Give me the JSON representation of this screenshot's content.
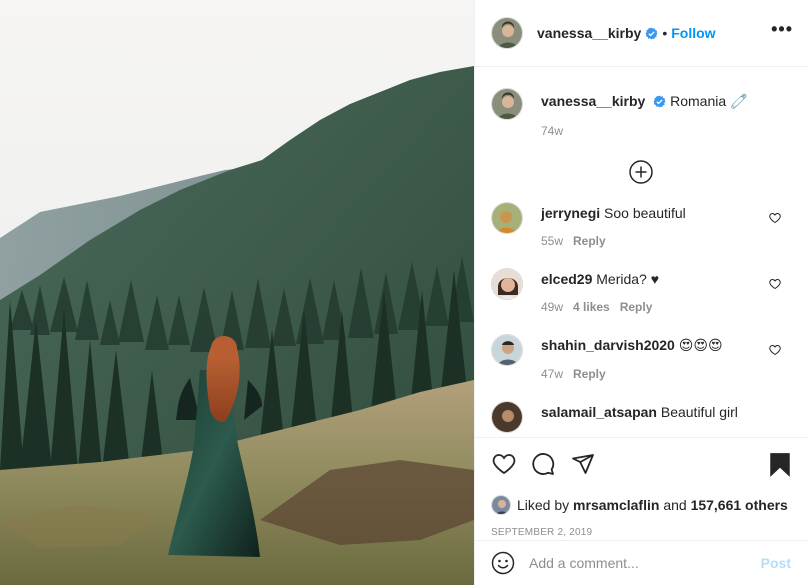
{
  "post": {
    "username": "vanessa__kirby",
    "separator": "•",
    "follow_label": "Follow",
    "more_label": "•••",
    "caption_text": "Romania",
    "caption_emoji": "🧷",
    "caption_age": "74w",
    "date": "SEPTEMBER 2, 2019"
  },
  "comments": [
    {
      "user": "jerrynegi",
      "text": "Soo beautiful",
      "age": "55w",
      "likes": "",
      "reply": "Reply"
    },
    {
      "user": "elced29",
      "text": "Merida? ♥",
      "age": "49w",
      "likes": "4 likes",
      "reply": "Reply"
    },
    {
      "user": "shahin_darvish2020",
      "text": "😍😍😍",
      "age": "47w",
      "likes": "",
      "reply": "Reply"
    },
    {
      "user": "salamail_atsapan",
      "text": "Beautiful girl",
      "age": "",
      "likes": "",
      "reply": ""
    }
  ],
  "likes": {
    "prefix": "Liked by",
    "user": "mrsamclaflin",
    "and": "and",
    "count": "157,661 others"
  },
  "add_comment": {
    "placeholder": "Add a comment...",
    "post_label": "Post"
  },
  "icons": {
    "heart": "heart-icon",
    "comment": "comment-icon",
    "share": "paper-plane-icon",
    "save": "bookmark-icon",
    "emoji": "smiley-icon",
    "load_more": "plus-circle-icon",
    "verified": "verified-badge-icon"
  },
  "colors": {
    "accent": "#0095f6",
    "verified": "#3897f0",
    "muted": "#8e8e8e",
    "post_disabled": "#b2dffc",
    "border": "#efefef"
  }
}
